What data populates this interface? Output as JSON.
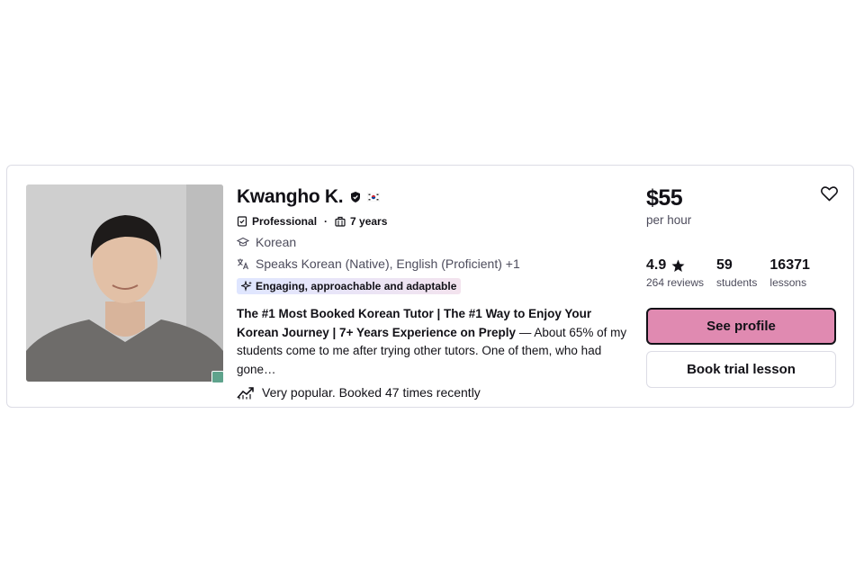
{
  "tutor": {
    "name": "Kwangho K.",
    "badge": "Professional",
    "experience": "7 years",
    "subject": "Korean",
    "languages": "Speaks Korean (Native), English (Proficient) +1",
    "tag": "Engaging, approachable and adaptable",
    "headline": "The #1 Most Booked Korean Tutor | The #1 Way to Enjoy Your Korean Journey | 7+ Years Experience on Preply",
    "description": " — About 65% of my students come to me after trying other tutors. One of them, who had gone…",
    "popularity": "Very popular. Booked 47 times recently"
  },
  "pricing": {
    "price": "$55",
    "unit": "per hour"
  },
  "stats": {
    "rating": "4.9",
    "reviews": "264 reviews",
    "students_count": "59",
    "students_label": "students",
    "lessons_count": "16371",
    "lessons_label": "lessons"
  },
  "actions": {
    "see_profile": "See profile",
    "book_trial": "Book trial lesson"
  },
  "colors": {
    "accent": "#e08ab1",
    "online": "#5fa38c",
    "border": "#dcdce5"
  },
  "icons": [
    "verified-icon",
    "korea-flag-icon",
    "professional-icon",
    "briefcase-icon",
    "graduation-cap-icon",
    "translate-icon",
    "sparkle-icon",
    "trending-icon",
    "star-icon",
    "heart-icon"
  ]
}
